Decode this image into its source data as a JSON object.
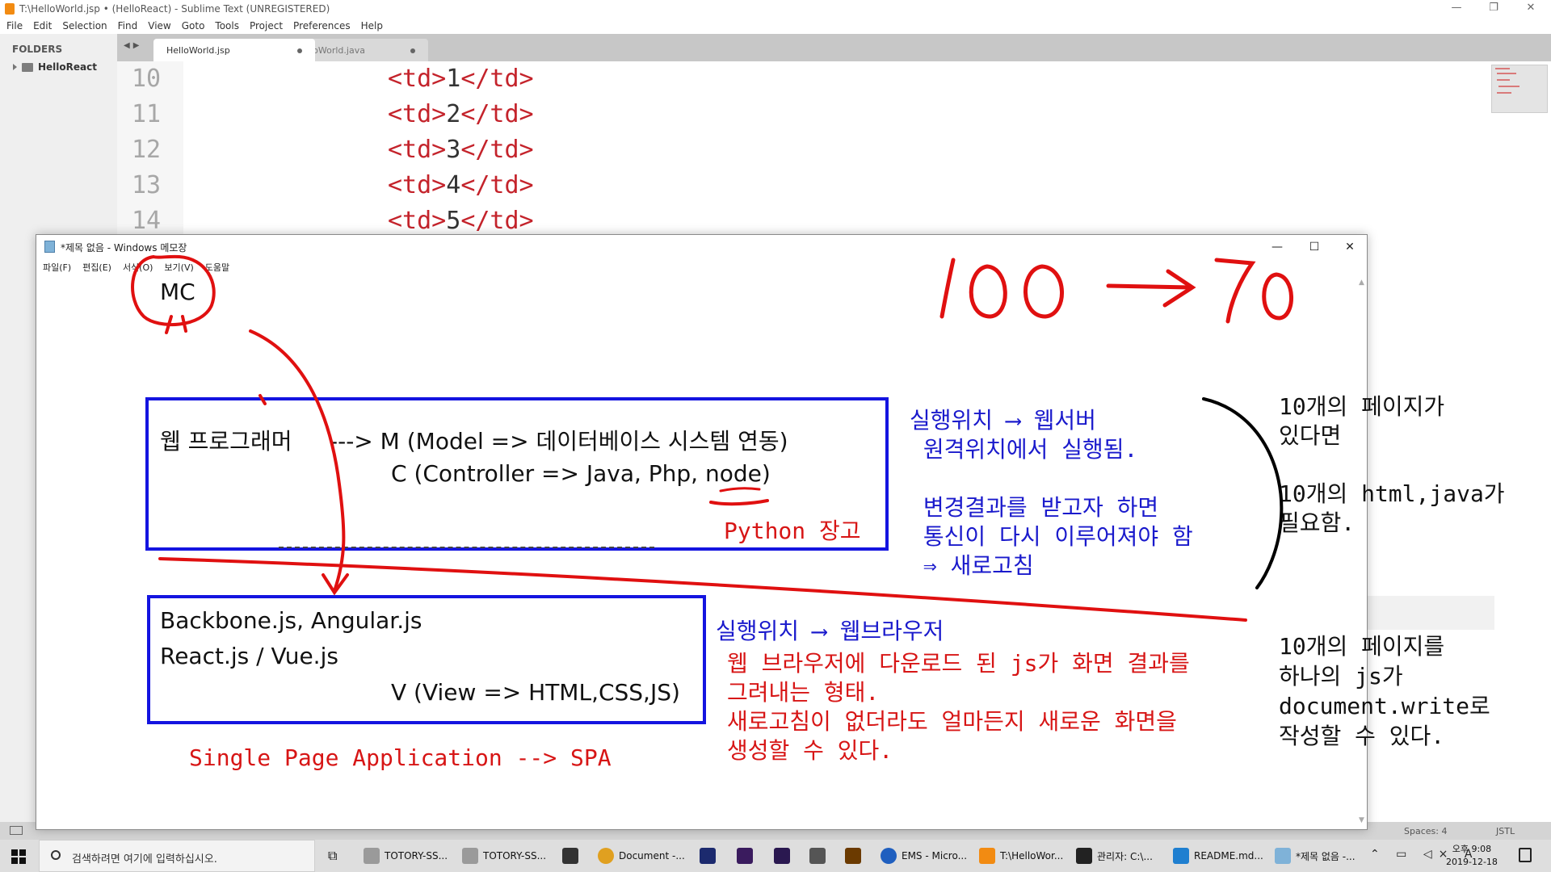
{
  "sublime": {
    "window_title": "T:\\HelloWorld.jsp • (HelloReact) - Sublime Text (UNREGISTERED)",
    "menu": [
      "File",
      "Edit",
      "Selection",
      "Find",
      "View",
      "Goto",
      "Tools",
      "Project",
      "Preferences",
      "Help"
    ],
    "sidebar": {
      "heading": "FOLDERS",
      "folder": "HelloReact"
    },
    "tabs": [
      {
        "label": "HelloWorld.jsp",
        "active": true
      },
      {
        "label": "HelloWorld.java",
        "active": false
      }
    ],
    "lines": [
      {
        "num": "10",
        "value": "1"
      },
      {
        "num": "11",
        "value": "2"
      },
      {
        "num": "12",
        "value": "3"
      },
      {
        "num": "13",
        "value": "4"
      },
      {
        "num": "14",
        "value": "5"
      }
    ],
    "tag_open": "<td>",
    "tag_close": "</td>",
    "status": {
      "spaces": "Spaces: 4",
      "syntax": "JSTL"
    }
  },
  "notepad": {
    "window_title": "*제목 없음 - Windows 메모장",
    "menu": [
      "파일(F)",
      "편집(E)",
      "서식(O)",
      "보기(V)",
      "도움말"
    ],
    "mvc": "MC",
    "box1": {
      "line1_left": "웹 프로그래머",
      "line1_right": "---> M (Model => 데이터베이스 시스템 연동)",
      "line2": "C (Controller => Java, Php, node)",
      "python": "Python 장고"
    },
    "dashes": "----------------------------------",
    "box2": {
      "line1": "Backbone.js, Angular.js",
      "line2": "React.js / Vue.js",
      "line3": "V (View => HTML,CSS,JS)"
    },
    "spa": "Single Page Application --> SPA",
    "server_side": [
      "실행위치 ⟶ 웹서버",
      " 원격위치에서 실행됨.",
      "",
      " 변경결과를 받고자 하면",
      " 통신이 다시 이루어져야 함",
      " ⇒ 새로고침"
    ],
    "client_side": {
      "title": "실행위치 ⟶ 웹브라우저",
      "lines": [
        "웹 브라우저에 다운로드 된 js가 화면 결과를",
        "그려내는 형태.",
        "새로고침이 없더라도 얼마든지 새로운 화면을",
        "생성할 수 있다."
      ]
    }
  },
  "side_notes": {
    "top": [
      "10개의 페이지가",
      "있다면",
      "",
      "10개의 html,java가",
      "필요함."
    ],
    "bottom": [
      "10개의 페이지를",
      "하나의 js가",
      "document.write로",
      "작성할 수 있다."
    ]
  },
  "taskbar": {
    "search_placeholder": "검색하려면 여기에 입력하십시오.",
    "items": [
      {
        "label": "TOTORY-SS...",
        "color": "#9a9a9a"
      },
      {
        "label": "TOTORY-SS...",
        "color": "#9a9a9a"
      },
      {
        "label": "",
        "color": "#333333"
      },
      {
        "label": "Document -...",
        "color": "#e0a020"
      },
      {
        "label": "",
        "color": "#1c2a6e"
      },
      {
        "label": "",
        "color": "#3a1b5e"
      },
      {
        "label": "",
        "color": "#2a1850"
      },
      {
        "label": "",
        "color": "#555555"
      },
      {
        "label": "",
        "color": "#6b3a00"
      },
      {
        "label": "EMS - Micro...",
        "color": "#1f5fbf"
      },
      {
        "label": "T:\\HelloWor...",
        "color": "#f28b12"
      },
      {
        "label": "관리자: C:\\...",
        "color": "#222222"
      },
      {
        "label": "README.md...",
        "color": "#1f7fd0"
      },
      {
        "label": "*제목 없음 -...",
        "color": "#7fb2d8"
      }
    ],
    "clock": {
      "time": "오후 9:08",
      "date": "2019-12-18"
    },
    "ime": "A"
  },
  "colors": {
    "ink_red": "#e01010",
    "ink_black": "#000000",
    "box_blue": "#1414e0",
    "text_red": "#d71515",
    "text_blue": "#1a1acc"
  }
}
